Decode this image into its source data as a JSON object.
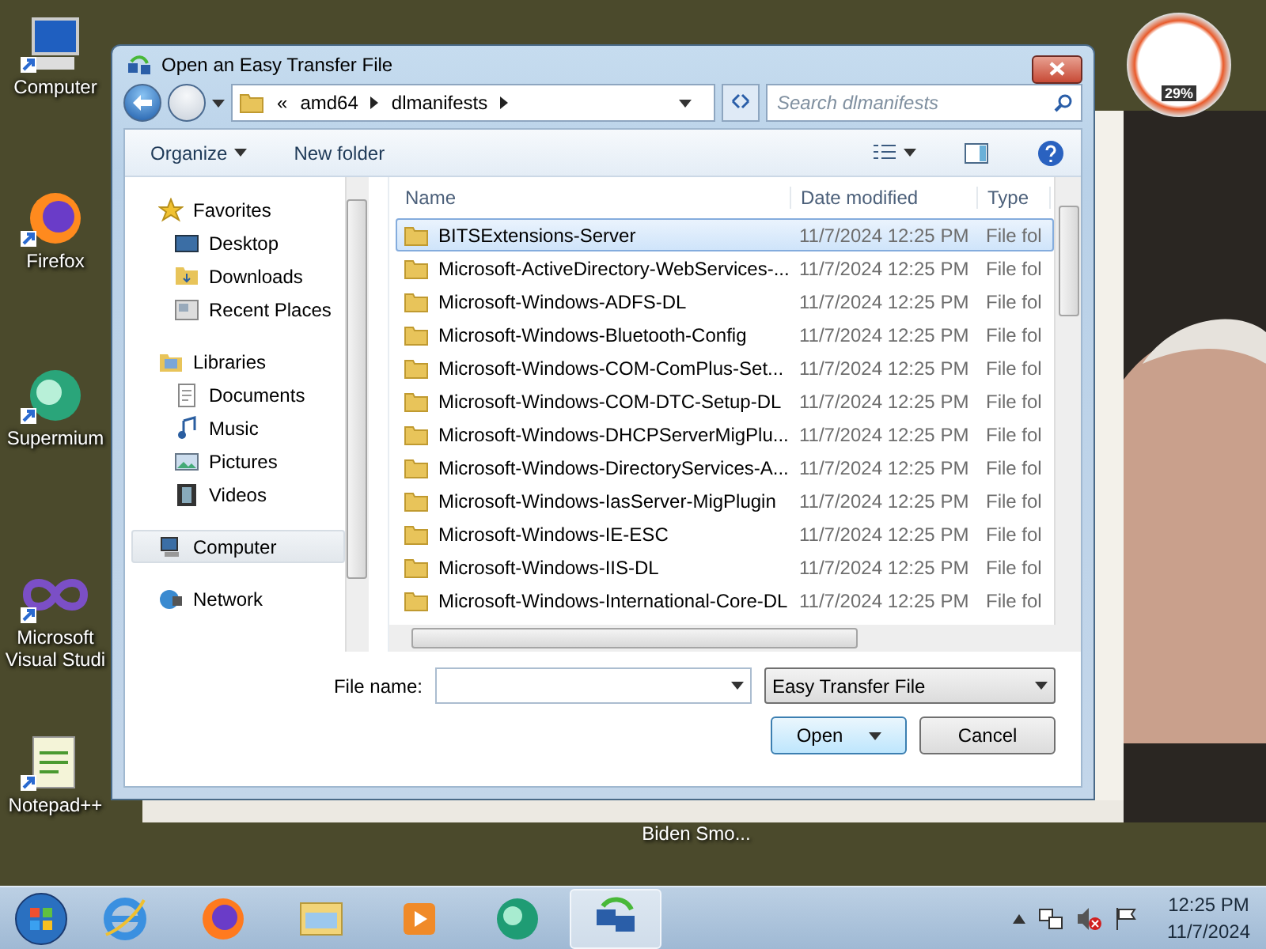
{
  "desktop_icons": [
    {
      "label": "Computer",
      "kind": "computer"
    },
    {
      "label": "Firefox",
      "kind": "firefox"
    },
    {
      "label": "Supermium",
      "kind": "supermium"
    },
    {
      "label": "Microsoft Visual Studi",
      "kind": "vs"
    },
    {
      "label": "Notepad++",
      "kind": "notepad"
    }
  ],
  "background_window": {
    "caption": "Biden Smo..."
  },
  "gadget": {
    "reading": "29%"
  },
  "dialog": {
    "title": "Open an Easy Transfer File",
    "breadcrumb": [
      "«",
      "amd64",
      "dlmanifests"
    ],
    "search": {
      "placeholder": "Search dlmanifests"
    },
    "toolbar": [
      "Organize",
      "New folder"
    ],
    "nav": [
      {
        "label": "Favorites",
        "kind": "favorites",
        "selected": false,
        "children": [
          {
            "label": "Desktop",
            "kind": "desktop",
            "selected": false
          },
          {
            "label": "Downloads",
            "kind": "downloads",
            "selected": false
          },
          {
            "label": "Recent Places",
            "kind": "recent",
            "selected": false
          }
        ]
      },
      {
        "label": "Libraries",
        "kind": "libraries",
        "selected": false,
        "children": [
          {
            "label": "Documents",
            "kind": "documents",
            "selected": false
          },
          {
            "label": "Music",
            "kind": "music",
            "selected": false
          },
          {
            "label": "Pictures",
            "kind": "pictures",
            "selected": false
          },
          {
            "label": "Videos",
            "kind": "videos",
            "selected": false
          }
        ]
      },
      {
        "label": "Computer",
        "kind": "computer",
        "selected": true
      },
      {
        "label": "Network",
        "kind": "network",
        "selected": false
      }
    ],
    "columns": [
      "Name",
      "Date modified",
      "Type"
    ],
    "rows": [
      {
        "name": "BITSExtensions-Server",
        "date": "11/7/2024 12:25 PM",
        "type": "File fol",
        "selected": true
      },
      {
        "name": "Microsoft-ActiveDirectory-WebServices-...",
        "date": "11/7/2024 12:25 PM",
        "type": "File fol",
        "selected": false
      },
      {
        "name": "Microsoft-Windows-ADFS-DL",
        "date": "11/7/2024 12:25 PM",
        "type": "File fol",
        "selected": false
      },
      {
        "name": "Microsoft-Windows-Bluetooth-Config",
        "date": "11/7/2024 12:25 PM",
        "type": "File fol",
        "selected": false
      },
      {
        "name": "Microsoft-Windows-COM-ComPlus-Set...",
        "date": "11/7/2024 12:25 PM",
        "type": "File fol",
        "selected": false
      },
      {
        "name": "Microsoft-Windows-COM-DTC-Setup-DL",
        "date": "11/7/2024 12:25 PM",
        "type": "File fol",
        "selected": false
      },
      {
        "name": "Microsoft-Windows-DHCPServerMigPlu...",
        "date": "11/7/2024 12:25 PM",
        "type": "File fol",
        "selected": false
      },
      {
        "name": "Microsoft-Windows-DirectoryServices-A...",
        "date": "11/7/2024 12:25 PM",
        "type": "File fol",
        "selected": false
      },
      {
        "name": "Microsoft-Windows-IasServer-MigPlugin",
        "date": "11/7/2024 12:25 PM",
        "type": "File fol",
        "selected": false
      },
      {
        "name": "Microsoft-Windows-IE-ESC",
        "date": "11/7/2024 12:25 PM",
        "type": "File fol",
        "selected": false
      },
      {
        "name": "Microsoft-Windows-IIS-DL",
        "date": "11/7/2024 12:25 PM",
        "type": "File fol",
        "selected": false
      },
      {
        "name": "Microsoft-Windows-International-Core-DL",
        "date": "11/7/2024 12:25 PM",
        "type": "File fol",
        "selected": false
      }
    ],
    "file_name": {
      "label": "File name:"
    },
    "file_type": "Easy Transfer File",
    "buttons": [
      "Open",
      "Cancel"
    ]
  },
  "taskbar": {
    "apps": [
      {
        "kind": "ie",
        "selected": false
      },
      {
        "kind": "firefox",
        "selected": false
      },
      {
        "kind": "explorer",
        "selected": false
      },
      {
        "kind": "media",
        "selected": false
      },
      {
        "kind": "supermium",
        "selected": false
      },
      {
        "kind": "transfer",
        "selected": true
      }
    ],
    "time": "12:25 PM",
    "date": "11/7/2024"
  }
}
